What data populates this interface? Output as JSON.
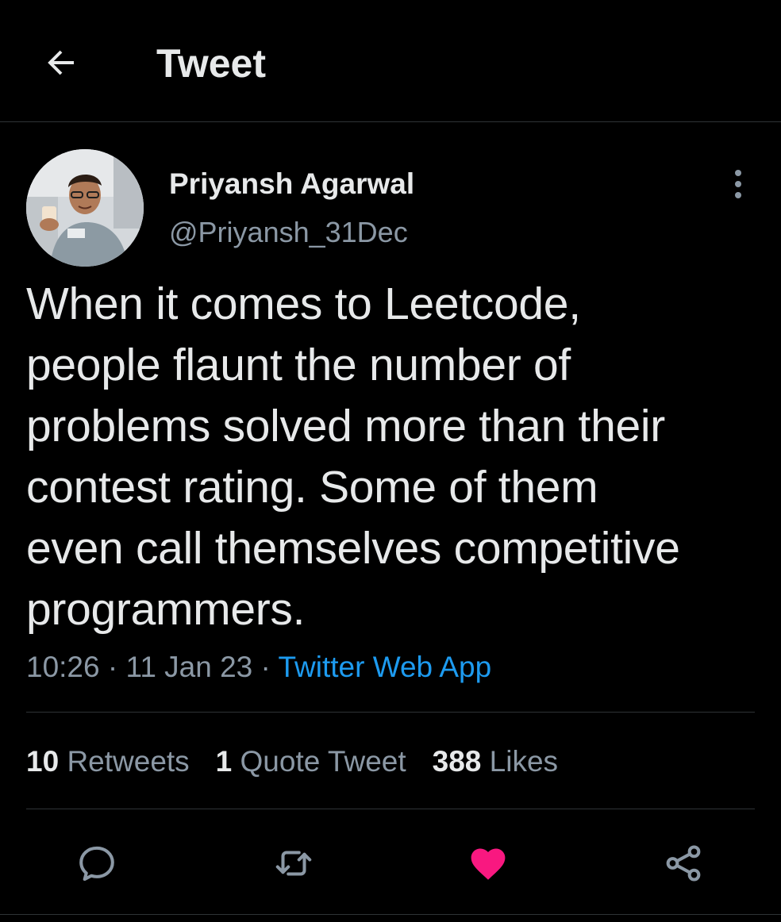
{
  "header": {
    "back_icon": "arrow-left-icon",
    "title": "Tweet"
  },
  "author": {
    "display_name": "Priyansh Agarwal",
    "handle": "@Priyansh_31Dec",
    "more_icon": "more-vertical-icon"
  },
  "tweet": {
    "text": "When it comes to Leetcode,\npeople flaunt the number of\nproblems solved more than their\ncontest rating. Some of them\neven call themselves competitive\nprogrammers.",
    "time": "10:26",
    "date": "11 Jan 23",
    "separator": " · ",
    "source": "Twitter Web App"
  },
  "stats": {
    "retweets_count": "10",
    "retweets_label": "Retweets",
    "quotes_count": "1",
    "quotes_label": "Quote Tweet",
    "likes_count": "388",
    "likes_label": "Likes"
  },
  "actions": {
    "reply_icon": "reply-icon",
    "retweet_icon": "retweet-icon",
    "like_icon": "heart-icon",
    "like_active": true,
    "share_icon": "share-icon"
  },
  "colors": {
    "background": "#000000",
    "text": "#e7e9ea",
    "secondary": "#8b98a5",
    "link": "#1d9bf0",
    "like": "#f91880",
    "divider": "#2f3336"
  }
}
